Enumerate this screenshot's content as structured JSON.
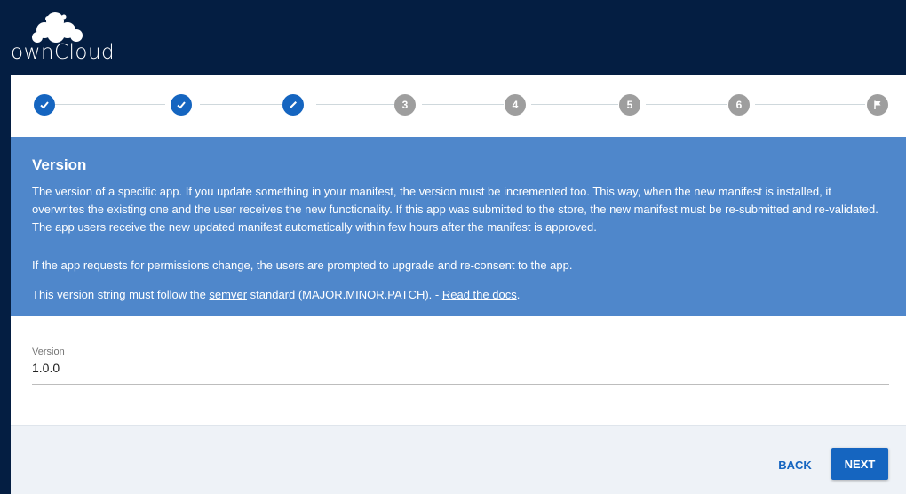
{
  "brand": {
    "logo_text": "ownCloud"
  },
  "stepper": {
    "steps": [
      {
        "state": "done",
        "icon": "check-icon"
      },
      {
        "state": "done",
        "icon": "check-icon"
      },
      {
        "state": "active",
        "icon": "pencil-icon"
      },
      {
        "state": "todo",
        "label": "3"
      },
      {
        "state": "todo",
        "label": "4"
      },
      {
        "state": "todo",
        "label": "5"
      },
      {
        "state": "todo",
        "label": "6"
      },
      {
        "state": "todo",
        "icon": "flag-icon"
      }
    ]
  },
  "info": {
    "title": "Version",
    "paragraph1": "The version of a specific app. If you update something in your manifest, the version must be incremented too. This way, when the new manifest is installed, it overwrites the existing one and the user receives the new functionality. If this app was submitted to the store, the new manifest must be re-submitted and re-validated. The app users receive the new updated manifest automatically within few hours after the manifest is approved.",
    "paragraph2": "If the app requests for permissions change, the users are prompted to upgrade and re-consent to the app.",
    "p3_prefix": "This version string must follow the ",
    "p3_link_semver": "semver",
    "p3_middle": " standard (MAJOR.MINOR.PATCH). - ",
    "p3_link_docs": "Read the docs",
    "p3_suffix": "."
  },
  "form": {
    "version_label": "Version",
    "version_value": "1.0.0"
  },
  "footer": {
    "back_label": "BACK",
    "next_label": "NEXT"
  },
  "colors": {
    "header_bg": "#041e42",
    "info_bg": "#4f87cb",
    "accent": "#1565c0",
    "step_todo": "#9e9e9e"
  }
}
